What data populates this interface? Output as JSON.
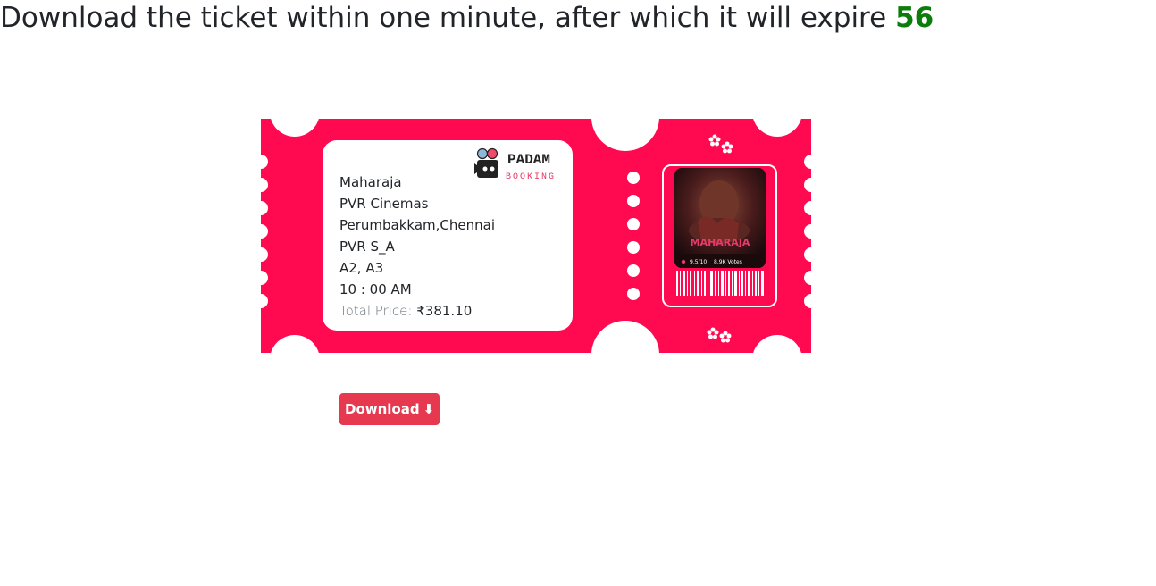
{
  "header": {
    "message": "Download the ticket within one minute, after which it will expire",
    "countdown": "56"
  },
  "ticket": {
    "logo_title": "PADAM",
    "logo_subtitle": "BOOKING",
    "movie": "Maharaja",
    "cinema": "PVR Cinemas",
    "location": "Perumbakkam,Chennai",
    "screen": "PVR S_A",
    "seats": "A2, A3",
    "time": "10 : 00 AM",
    "price_label": "Total Price:",
    "price_value": "₹381.10",
    "poster": {
      "title": "MAHARAJA",
      "rating": "9.5/10",
      "votes": "8.9K Votes"
    }
  },
  "actions": {
    "download_label": "Download",
    "download_icon": "⬇"
  },
  "colors": {
    "ticket": "#ff0a50",
    "button": "#e63950",
    "countdown": "#0a7d0a"
  }
}
